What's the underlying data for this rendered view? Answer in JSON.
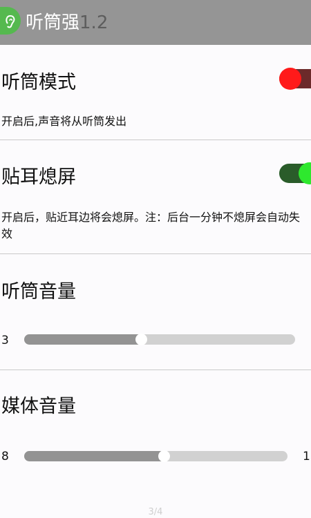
{
  "appbar": {
    "title": "听筒强",
    "version": "1.2",
    "icon": "ear-icon",
    "icon_color": "#55b94f",
    "background": "#959595"
  },
  "earpiece_mode": {
    "title": "听筒模式",
    "description": "开启后,声音将从听筒发出",
    "enabled": false,
    "thumb_color": "#ff1a1a"
  },
  "proximity_screen_off": {
    "title": "贴耳熄屏",
    "description": "开启后，贴近耳边将会熄屏。注：后台一分钟不熄屏会自动失效",
    "enabled": true,
    "thumb_color": "#2ee82e"
  },
  "earpiece_volume": {
    "title": "听筒音量",
    "value_label": "3",
    "level_fraction": 0.43
  },
  "media_volume": {
    "title": "媒体音量",
    "min_label": "8",
    "max_label": "1",
    "level_fraction": 0.53
  },
  "page_indicator": "3/4"
}
